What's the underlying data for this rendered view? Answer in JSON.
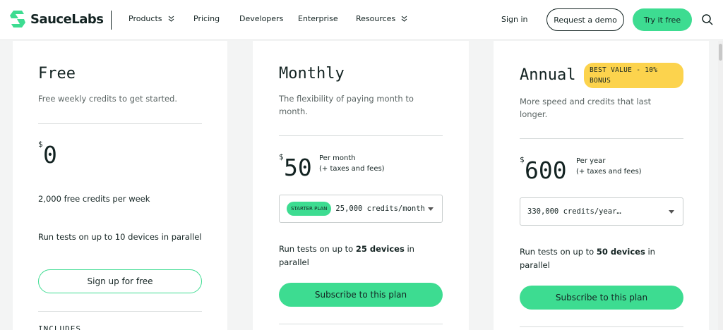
{
  "nav": {
    "brand": "SauceLabs",
    "items": [
      {
        "label": "Products",
        "has_menu": true
      },
      {
        "label": "Pricing",
        "has_menu": false
      },
      {
        "label": "Developers",
        "has_menu": false
      },
      {
        "label": "Enterprise",
        "has_menu": false
      },
      {
        "label": "Resources",
        "has_menu": true
      }
    ],
    "signin": "Sign in",
    "demo": "Request a demo",
    "try": "Try it free"
  },
  "plans": {
    "free": {
      "title": "Free",
      "desc": "Free weekly credits to get started.",
      "currency": "$",
      "price": "0",
      "credits": "2,000 free credits per week",
      "parallel": "Run tests on up to 10 devices in parallel",
      "cta": "Sign up for free",
      "includes": "INCLUDES"
    },
    "monthly": {
      "title": "Monthly",
      "desc": "The flexibility of paying month to month.",
      "currency": "$",
      "price": "50",
      "period_line1": "Per month",
      "period_line2": "(+ taxes and fees)",
      "badge": "STARTER PLAN",
      "select_value": "25,000 credits/month",
      "parallel_pre": "Run tests on up to ",
      "parallel_bold": "25 devices",
      "parallel_post": " in parallel",
      "cta": "Subscribe to this plan"
    },
    "annual": {
      "title": "Annual",
      "best_value": "BEST VALUE - 10% BONUS",
      "desc": "More speed and credits that last longer.",
      "currency": "$",
      "price": "600",
      "period_line1": "Per year",
      "period_line2": "(+ taxes and fees)",
      "select_value": "330,000 credits/year…",
      "parallel_pre": "Run tests on up to ",
      "parallel_bold": "50 devices",
      "parallel_post": " in parallel",
      "cta": "Subscribe to this plan"
    }
  },
  "colors": {
    "accent": "#3ddc91",
    "badge_yellow": "#fcd34d",
    "text": "#132322"
  }
}
